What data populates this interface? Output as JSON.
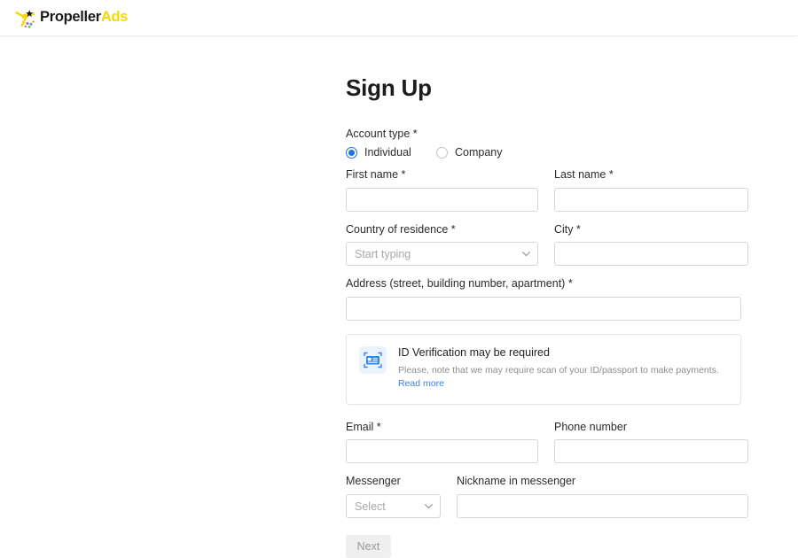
{
  "brand": {
    "logo_icon": "propeller-pinwheel-icon",
    "name_primary": "Propeller",
    "name_accent": "Ads",
    "color_accent": "#f5d800",
    "color_primary": "#1a1a1a"
  },
  "page": {
    "title": "Sign Up"
  },
  "colors": {
    "radio_selected": "#1a73e8",
    "link": "#3b82e6",
    "notice_icon_bg": "#eaf3fe",
    "input_border": "#d6d6d6",
    "button_disabled_bg": "#efefef",
    "button_disabled_text": "#9a9a9a"
  },
  "form": {
    "account_type": {
      "label": "Account type *",
      "options": [
        {
          "label": "Individual",
          "selected": true
        },
        {
          "label": "Company",
          "selected": false
        }
      ]
    },
    "first_name": {
      "label": "First name *",
      "value": "",
      "placeholder": ""
    },
    "last_name": {
      "label": "Last name *",
      "value": "",
      "placeholder": ""
    },
    "country": {
      "label": "Country of residence *",
      "value": "",
      "placeholder": "Start typing",
      "icon": "chevron-down-icon"
    },
    "city": {
      "label": "City *",
      "value": "",
      "placeholder": ""
    },
    "address": {
      "label": "Address (street, building number, apartment) *",
      "value": "",
      "placeholder": ""
    },
    "email": {
      "label": "Email *",
      "value": "",
      "placeholder": ""
    },
    "phone": {
      "label": "Phone number",
      "value": "",
      "placeholder": ""
    },
    "messenger": {
      "label": "Messenger",
      "value": "",
      "placeholder": "Select",
      "icon": "chevron-down-icon"
    },
    "nickname": {
      "label": "Nickname in messenger",
      "value": "",
      "placeholder": ""
    },
    "submit_label": "Next"
  },
  "notice": {
    "icon": "id-card-scan-icon",
    "title": "ID Verification may be required",
    "text": "Please, note that we may require scan of your ID/passport to make payments. ",
    "link_label": "Read more"
  }
}
